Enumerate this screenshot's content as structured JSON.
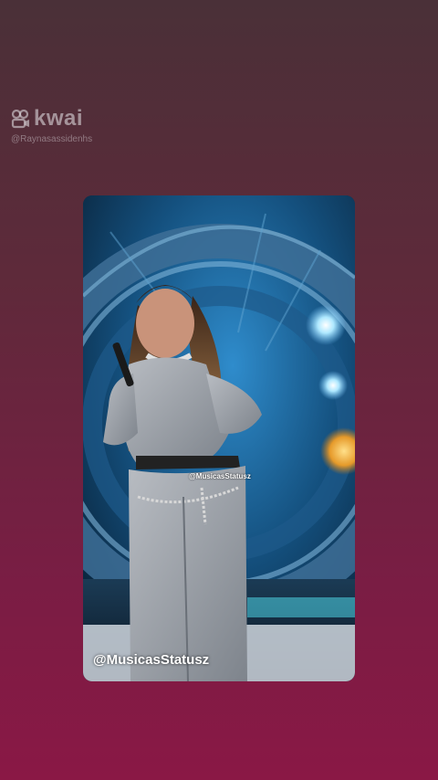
{
  "watermark": {
    "brand": "kwai",
    "handle": "@Raynasassidenhs"
  },
  "video": {
    "overlay_center": "@MusicasStatusz",
    "overlay_bottom": "@MusicasStatusz"
  },
  "icons": {
    "brand_logo": "kwai-logo-icon"
  },
  "colors": {
    "background_top": "#4a3038",
    "background_bottom": "#8a1845",
    "stage_blue": "#1e6fa8",
    "stage_light": "#9fe2ff"
  }
}
